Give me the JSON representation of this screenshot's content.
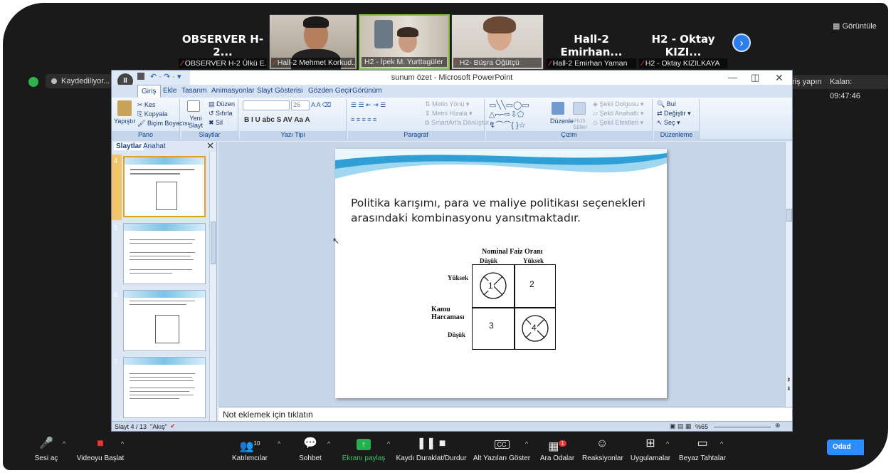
{
  "zoom": {
    "top_right_label": "Görüntüle",
    "participants": [
      {
        "big_name": "OBSERVER H-2...",
        "label": "OBSERVER H-2 Ülkü E..."
      },
      {
        "label": "Hall-2 Mehmet Korkud..."
      },
      {
        "label": "H2 - İpek M. Yurttagüler"
      },
      {
        "label": "H2- Büşra Öğütçü"
      },
      {
        "big_name": "Hall-2 Emirhan...",
        "label": "Hall-2 Emirhan Yaman"
      },
      {
        "big_name": "H2 - Oktay KIZI...",
        "label": "H2 - Oktay KIZILKAYA"
      }
    ],
    "recording_label": "Kaydediliyor...",
    "giris_label": "Giriş yapın",
    "kalan_label": "Kalan: 09:47:46",
    "toolbar": {
      "mute": "Sesi aç",
      "video": "Videoyu Başlat",
      "participants": "Katılımcılar",
      "participants_count": "10",
      "chat": "Sohbet",
      "share": "Ekranı paylaş",
      "record": "Kaydı Duraklat/Durdur",
      "cc": "Alt Yazıları Göster",
      "cc_icon": "CC",
      "breakout": "Ara Odalar",
      "breakout_badge": "1",
      "reactions": "Reaksiyonlar",
      "apps": "Uygulamalar",
      "whiteboard": "Beyaz Tahtalar",
      "end": "Odad"
    }
  },
  "ppt": {
    "title": "sunum özet - Microsoft PowerPoint",
    "tabs": [
      "Giriş",
      "Ekle",
      "Tasarım",
      "Animasyonlar",
      "Slayt Gösterisi",
      "Gözden Geçir",
      "Görünüm"
    ],
    "ribbon": {
      "pano": {
        "paste": "Yapıştır",
        "cut": "Kes",
        "copy": "Kopyala",
        "format_painter": "Biçim Boyacısı",
        "label": "Pano"
      },
      "slaytlar": {
        "new_slide": "Yeni Slayt",
        "layout": "Düzen",
        "reset": "Sıfırla",
        "delete": "Sil",
        "label": "Slaytlar"
      },
      "yazi_tipi": {
        "font_size": "26",
        "label": "Yazı Tipi"
      },
      "paragraf": {
        "text_dir": "Metin Yönü",
        "align_text": "Metni Hizala",
        "smartart": "SmartArt'a Dönüştür",
        "label": "Paragraf"
      },
      "cizim": {
        "arrange": "Düzenle",
        "quick_styles": "Hızlı Stiller",
        "fill": "Şekil Dolgusu",
        "outline": "Şekil Anahattı",
        "effects": "Şekil Efektleri",
        "label": "Çizim"
      },
      "duzenleme": {
        "find": "Bul",
        "replace": "Değiştir",
        "select": "Seç",
        "label": "Düzenleme"
      }
    },
    "left_pane_tabs": [
      "Slaytlar",
      "Anahat"
    ],
    "thumb_numbers": [
      "4",
      "5",
      "6",
      "7"
    ],
    "slide": {
      "text": "Politika karışımı, para ve maliye politikası seçenekleri arasındaki kombinasyonu yansıtmaktadır.",
      "figure": {
        "title": "Nominal Faiz Oranı",
        "col_low": "Düşük",
        "col_high": "Yüksek",
        "row_high": "Yüksek",
        "row_axis_1": "Kamu",
        "row_axis_2": "Harcaması",
        "row_low": "Düşük",
        "cells": [
          "1",
          "2",
          "3",
          "4"
        ]
      }
    },
    "notes": "Not eklemek için tıklatın",
    "status": {
      "slide": "Slayt 4 / 13",
      "theme": "\"Akış\"",
      "zoom": "%65"
    }
  }
}
